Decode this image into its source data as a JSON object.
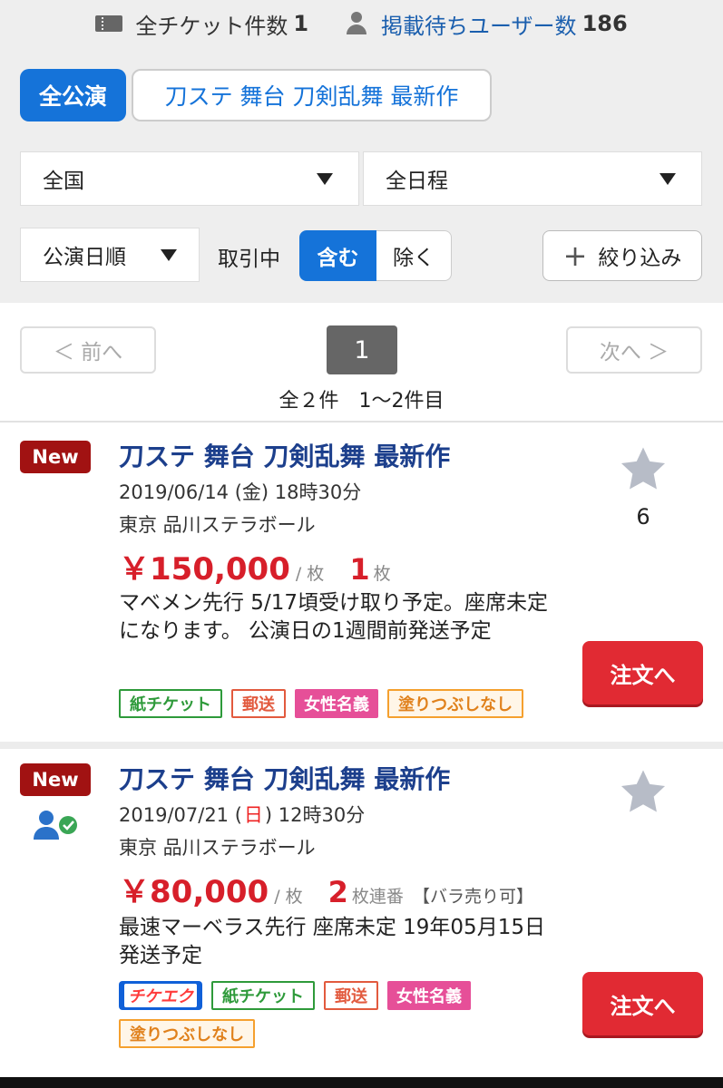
{
  "header": {
    "ticket_label": "全チケット件数",
    "ticket_count": "1",
    "waiting_label": "掲載待ちユーザー数",
    "waiting_count": "186"
  },
  "filters": {
    "all_label": "全公演",
    "keyword": "刀ステ 舞台 刀剣乱舞 最新作",
    "area": "全国",
    "schedule": "全日程",
    "sort": "公演日順",
    "trade_label": "取引中",
    "include_label": "含む",
    "exclude_label": "除く",
    "refine_label": "絞り込み"
  },
  "pager": {
    "prev": "＜ 前へ",
    "current": "1",
    "next": "次へ ＞",
    "summary": "全２件　1〜2件目"
  },
  "listings": [
    {
      "badge": "New",
      "title": "刀ステ 舞台 刀剣乱舞 最新作",
      "date_pre": "2019/06/14 (",
      "weekday": "金",
      "date_post": ") 18時30分",
      "venue": "東京 品川ステラボール",
      "price": "￥150,000",
      "unit": "/ 枚",
      "qty": "1",
      "qty_unit": "枚",
      "note": "マベメン先行 5/17頃受け取り予定。座席未定になります。 公演日の1週間前発送予定",
      "tags": [
        "紙チケット",
        "郵送",
        "女性名義",
        "塗りつぶしなし"
      ],
      "fav_count": "6",
      "order_label": "注文へ"
    },
    {
      "badge": "New",
      "title": "刀ステ 舞台 刀剣乱舞 最新作",
      "date_pre": "2019/07/21 (",
      "weekday": "日",
      "date_post": ") 12時30分",
      "venue": "東京 品川ステラボール",
      "price": "￥80,000",
      "unit": "/ 枚",
      "qty": "2",
      "qty_unit": "枚連番",
      "bara": "【バラ売り可】",
      "note": "最速マーベラス先行 座席未定 19年05月15日発送予定",
      "chikeeku": "チケエク",
      "tags": [
        "紙チケット",
        "郵送",
        "女性名義",
        "塗りつぶしなし"
      ],
      "order_label": "注文へ"
    }
  ],
  "colors": {
    "brand_blue": "#1573d9",
    "title_navy": "#1c3f8c",
    "price_red": "#d71f2a",
    "order_red": "#e12a33",
    "new_badge": "#a11212"
  }
}
